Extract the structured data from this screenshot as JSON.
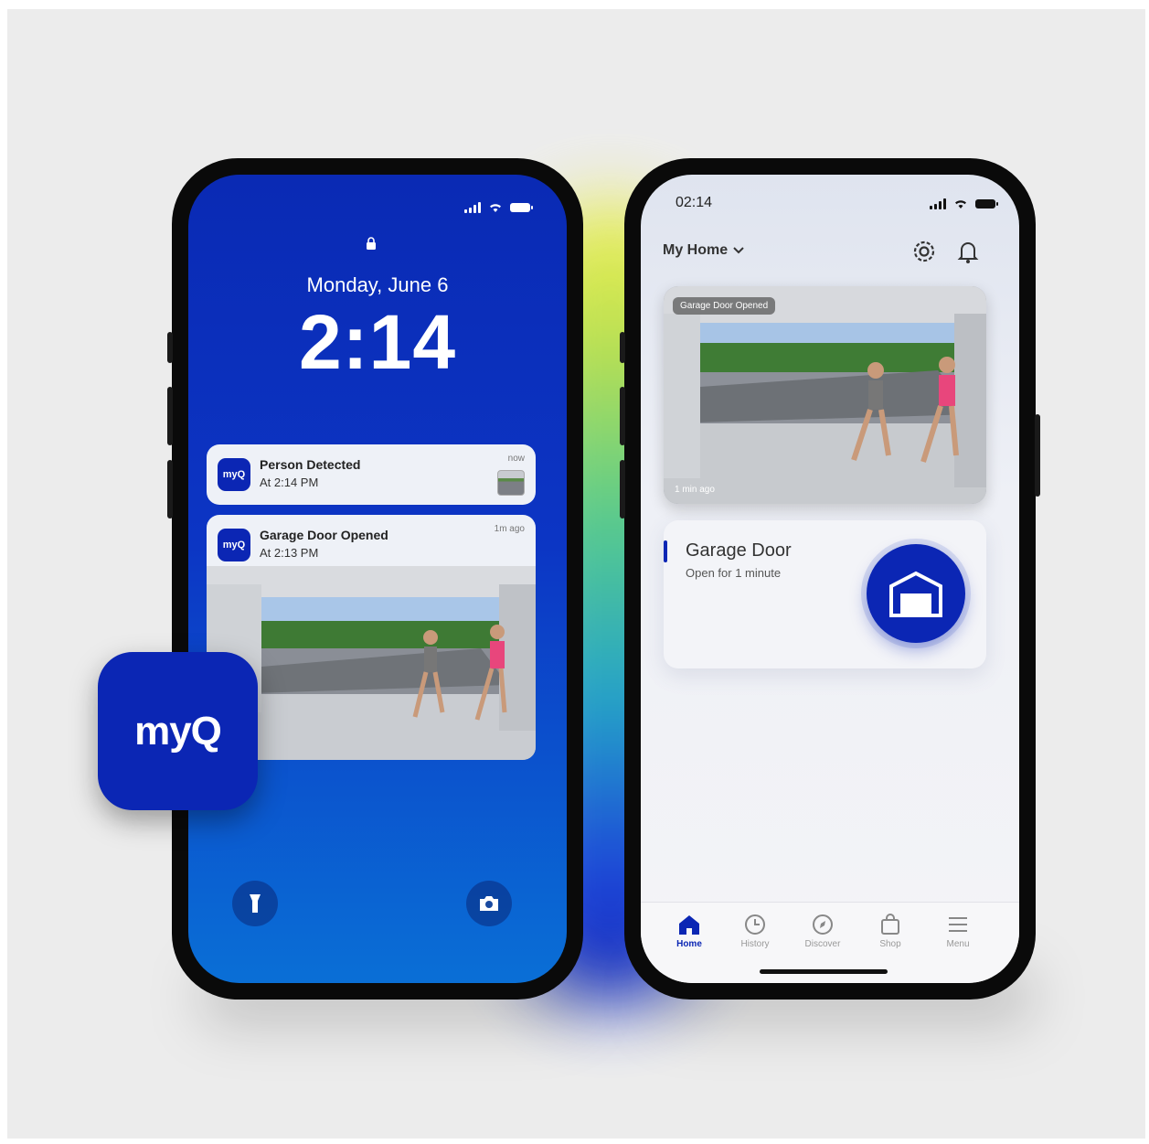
{
  "lock_screen": {
    "date": "Monday, June 6",
    "time": "2:14",
    "notifications": [
      {
        "app": "myQ",
        "title": "Person Detected",
        "subtitle": "At 2:14 PM",
        "time": "now"
      },
      {
        "app": "myQ",
        "title": "Garage Door Opened",
        "subtitle": "At 2:13 PM",
        "time": "1m ago"
      }
    ],
    "shortcuts": [
      "flashlight-icon",
      "camera-icon"
    ]
  },
  "app_icon": {
    "label": "myQ"
  },
  "app_screen": {
    "status_time": "02:14",
    "location": "My Home",
    "camera": {
      "badge": "Garage Door Opened",
      "ago": "1 min ago"
    },
    "door": {
      "title": "Garage Door",
      "status": "Open for 1 minute"
    },
    "tabs": [
      {
        "label": "Home",
        "icon": "home-icon",
        "active": true
      },
      {
        "label": "History",
        "icon": "clock-icon",
        "active": false
      },
      {
        "label": "Discover",
        "icon": "compass-icon",
        "active": false
      },
      {
        "label": "Shop",
        "icon": "bag-icon",
        "active": false
      },
      {
        "label": "Menu",
        "icon": "menu-icon",
        "active": false
      }
    ]
  },
  "colors": {
    "brand_blue": "#0b26b4",
    "lock_top": "#0a2ab4",
    "lock_bottom": "#0a6fd6"
  }
}
